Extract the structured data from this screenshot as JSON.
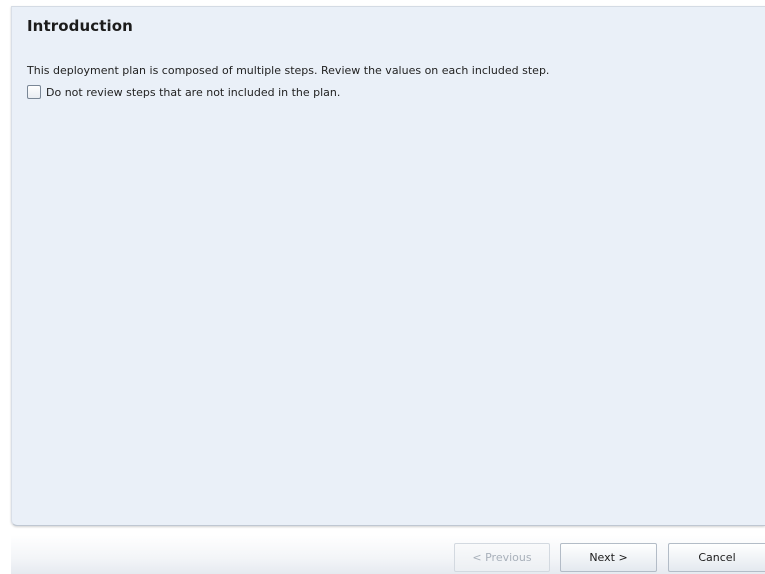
{
  "panel": {
    "title": "Introduction",
    "description": "This deployment plan is composed of multiple steps. Review the values on each included step.",
    "skip_option": {
      "label": "Do not review steps that are not included in the plan.",
      "checked": false
    }
  },
  "footer": {
    "previous_label": "< Previous",
    "previous_enabled": false,
    "next_label": "Next >",
    "cancel_label": "Cancel"
  }
}
